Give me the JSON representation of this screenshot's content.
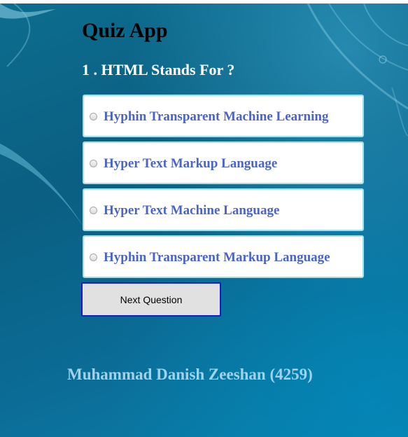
{
  "app": {
    "title": "Quiz App"
  },
  "question": {
    "text": "1 . HTML Stands For ?"
  },
  "options": [
    {
      "label": "Hyphin Transparent Machine Learning"
    },
    {
      "label": "Hyper Text Markup Language"
    },
    {
      "label": "Hyper Text Machine Language"
    },
    {
      "label": "Hyphin Transparent Markup Language"
    }
  ],
  "actions": {
    "next_label": "Next Question"
  },
  "footer": {
    "author": "Muhammad Danish Zeeshan (4259)"
  },
  "colors": {
    "background": "#0a6388",
    "option_text": "#4a64c8",
    "option_border": "#9fe0ea",
    "button_border": "#1b1bc8",
    "footer_text": "#9fd3ea"
  }
}
